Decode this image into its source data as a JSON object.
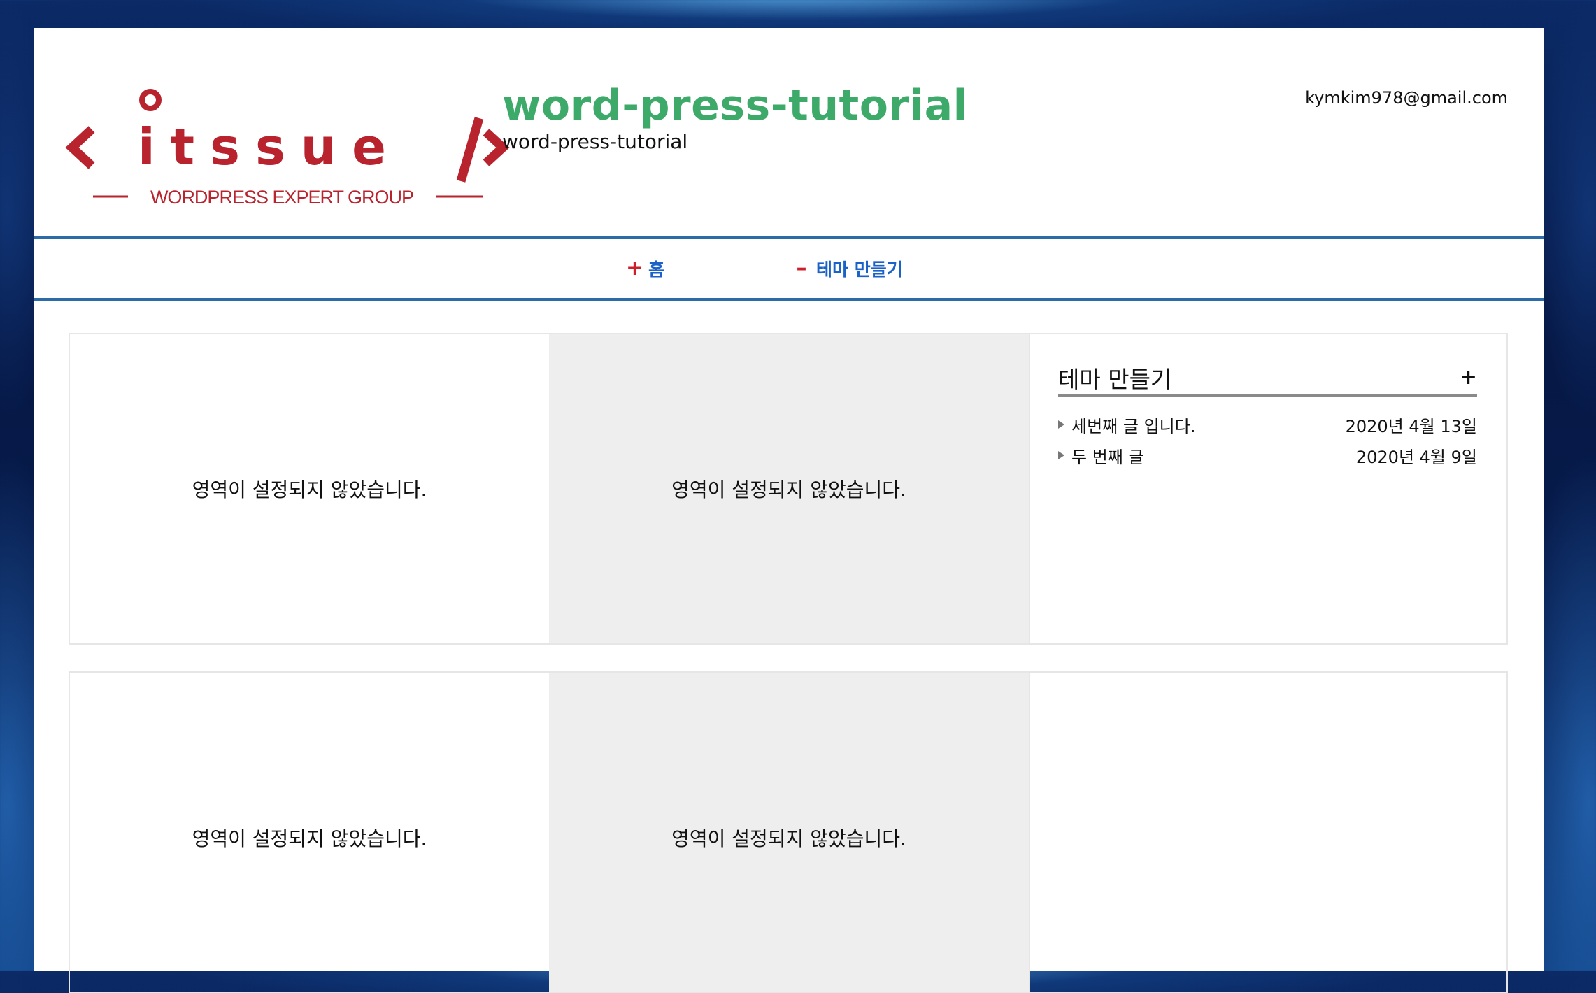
{
  "header": {
    "logo_text": "itssue",
    "logo_tagline": "WORDPRESS EXPERT GROUP",
    "site_title": "word-press-tutorial",
    "site_description": "word-press-tutorial",
    "email": "kymkim978@gmail.com"
  },
  "colors": {
    "title_green": "#3daa6a",
    "nav_blue": "#1a62c7",
    "nav_border": "#2d6aa8",
    "logo_red": "#b8232e",
    "accent_red": "#cc1f2a"
  },
  "nav": {
    "items": [
      {
        "sign": "+",
        "label": "홈"
      },
      {
        "sign": "–",
        "label": "테마 만들기"
      }
    ]
  },
  "rows": [
    {
      "cells": [
        "영역이 설정되지 않았습니다.",
        "영역이 설정되지 않았습니다."
      ]
    },
    {
      "cells": [
        "영역이 설정되지 않았습니다.",
        "영역이 설정되지 않았습니다."
      ]
    }
  ],
  "widget": {
    "title": "테마 만들기",
    "plus": "+",
    "posts": [
      {
        "title": "세번째 글 입니다.",
        "date": "2020년 4월 13일"
      },
      {
        "title": "두 번째 글",
        "date": "2020년 4월 9일"
      }
    ]
  }
}
